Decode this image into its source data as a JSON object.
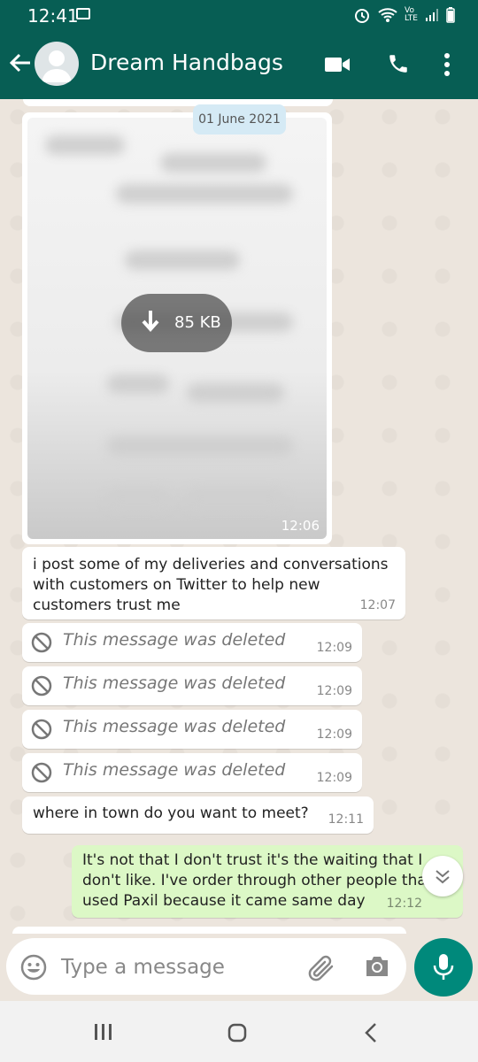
{
  "status": {
    "time": "12:41",
    "icons": [
      "image-icon",
      "alarm-icon",
      "wifi-icon",
      "volte-icon",
      "signal-icon",
      "battery-icon"
    ]
  },
  "header": {
    "contact_name": "Dream Handbags",
    "icons": [
      "back-arrow-icon",
      "avatar",
      "video-call-icon",
      "phone-icon",
      "more-options-icon"
    ]
  },
  "chat": {
    "date_chip": "01 June 2021",
    "image_message": {
      "download_size": "85 KB",
      "time": "12:06"
    },
    "messages": [
      {
        "type": "incoming",
        "text": "i post some of my deliveries and conversations with customers on Twitter to help new customers trust me",
        "time": "12:07"
      },
      {
        "type": "deleted",
        "text": "This message was deleted",
        "time": "12:09"
      },
      {
        "type": "deleted",
        "text": "This message was deleted",
        "time": "12:09"
      },
      {
        "type": "deleted",
        "text": "This message was deleted",
        "time": "12:09"
      },
      {
        "type": "deleted",
        "text": "This message was deleted",
        "time": "12:09"
      },
      {
        "type": "incoming",
        "text": "where in town do you want to meet?",
        "time": "12:11"
      },
      {
        "type": "outgoing",
        "text": "It's not that I don't trust it's the waiting that I don't like. I've order through other people that used Paxil because it came same day",
        "time": "12:12"
      }
    ]
  },
  "composer": {
    "placeholder": "Type a message"
  },
  "colors": {
    "header": "#075e54",
    "outgoing_bubble": "#dcf8c6",
    "fab": "#00897b",
    "background": "#ece5dd"
  }
}
